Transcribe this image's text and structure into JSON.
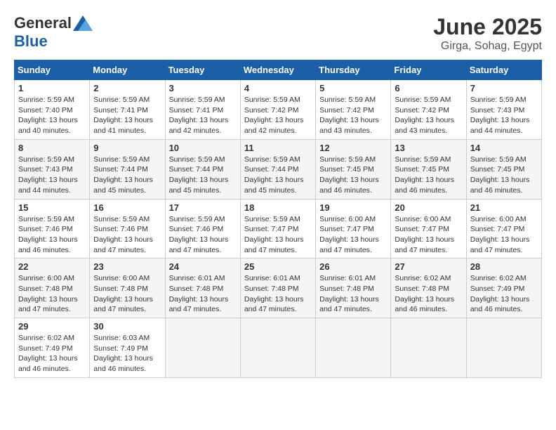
{
  "header": {
    "logo_general": "General",
    "logo_blue": "Blue",
    "month_title": "June 2025",
    "location": "Girga, Sohag, Egypt"
  },
  "weekdays": [
    "Sunday",
    "Monday",
    "Tuesday",
    "Wednesday",
    "Thursday",
    "Friday",
    "Saturday"
  ],
  "weeks": [
    [
      {
        "day": "1",
        "sunrise": "5:59 AM",
        "sunset": "7:40 PM",
        "daylight": "13 hours and 40 minutes."
      },
      {
        "day": "2",
        "sunrise": "5:59 AM",
        "sunset": "7:41 PM",
        "daylight": "13 hours and 41 minutes."
      },
      {
        "day": "3",
        "sunrise": "5:59 AM",
        "sunset": "7:41 PM",
        "daylight": "13 hours and 42 minutes."
      },
      {
        "day": "4",
        "sunrise": "5:59 AM",
        "sunset": "7:42 PM",
        "daylight": "13 hours and 42 minutes."
      },
      {
        "day": "5",
        "sunrise": "5:59 AM",
        "sunset": "7:42 PM",
        "daylight": "13 hours and 43 minutes."
      },
      {
        "day": "6",
        "sunrise": "5:59 AM",
        "sunset": "7:42 PM",
        "daylight": "13 hours and 43 minutes."
      },
      {
        "day": "7",
        "sunrise": "5:59 AM",
        "sunset": "7:43 PM",
        "daylight": "13 hours and 44 minutes."
      }
    ],
    [
      {
        "day": "8",
        "sunrise": "5:59 AM",
        "sunset": "7:43 PM",
        "daylight": "13 hours and 44 minutes."
      },
      {
        "day": "9",
        "sunrise": "5:59 AM",
        "sunset": "7:44 PM",
        "daylight": "13 hours and 45 minutes."
      },
      {
        "day": "10",
        "sunrise": "5:59 AM",
        "sunset": "7:44 PM",
        "daylight": "13 hours and 45 minutes."
      },
      {
        "day": "11",
        "sunrise": "5:59 AM",
        "sunset": "7:44 PM",
        "daylight": "13 hours and 45 minutes."
      },
      {
        "day": "12",
        "sunrise": "5:59 AM",
        "sunset": "7:45 PM",
        "daylight": "13 hours and 46 minutes."
      },
      {
        "day": "13",
        "sunrise": "5:59 AM",
        "sunset": "7:45 PM",
        "daylight": "13 hours and 46 minutes."
      },
      {
        "day": "14",
        "sunrise": "5:59 AM",
        "sunset": "7:45 PM",
        "daylight": "13 hours and 46 minutes."
      }
    ],
    [
      {
        "day": "15",
        "sunrise": "5:59 AM",
        "sunset": "7:46 PM",
        "daylight": "13 hours and 46 minutes."
      },
      {
        "day": "16",
        "sunrise": "5:59 AM",
        "sunset": "7:46 PM",
        "daylight": "13 hours and 47 minutes."
      },
      {
        "day": "17",
        "sunrise": "5:59 AM",
        "sunset": "7:46 PM",
        "daylight": "13 hours and 47 minutes."
      },
      {
        "day": "18",
        "sunrise": "5:59 AM",
        "sunset": "7:47 PM",
        "daylight": "13 hours and 47 minutes."
      },
      {
        "day": "19",
        "sunrise": "6:00 AM",
        "sunset": "7:47 PM",
        "daylight": "13 hours and 47 minutes."
      },
      {
        "day": "20",
        "sunrise": "6:00 AM",
        "sunset": "7:47 PM",
        "daylight": "13 hours and 47 minutes."
      },
      {
        "day": "21",
        "sunrise": "6:00 AM",
        "sunset": "7:47 PM",
        "daylight": "13 hours and 47 minutes."
      }
    ],
    [
      {
        "day": "22",
        "sunrise": "6:00 AM",
        "sunset": "7:48 PM",
        "daylight": "13 hours and 47 minutes."
      },
      {
        "day": "23",
        "sunrise": "6:00 AM",
        "sunset": "7:48 PM",
        "daylight": "13 hours and 47 minutes."
      },
      {
        "day": "24",
        "sunrise": "6:01 AM",
        "sunset": "7:48 PM",
        "daylight": "13 hours and 47 minutes."
      },
      {
        "day": "25",
        "sunrise": "6:01 AM",
        "sunset": "7:48 PM",
        "daylight": "13 hours and 47 minutes."
      },
      {
        "day": "26",
        "sunrise": "6:01 AM",
        "sunset": "7:48 PM",
        "daylight": "13 hours and 47 minutes."
      },
      {
        "day": "27",
        "sunrise": "6:02 AM",
        "sunset": "7:48 PM",
        "daylight": "13 hours and 46 minutes."
      },
      {
        "day": "28",
        "sunrise": "6:02 AM",
        "sunset": "7:49 PM",
        "daylight": "13 hours and 46 minutes."
      }
    ],
    [
      {
        "day": "29",
        "sunrise": "6:02 AM",
        "sunset": "7:49 PM",
        "daylight": "13 hours and 46 minutes."
      },
      {
        "day": "30",
        "sunrise": "6:03 AM",
        "sunset": "7:49 PM",
        "daylight": "13 hours and 46 minutes."
      },
      null,
      null,
      null,
      null,
      null
    ]
  ]
}
